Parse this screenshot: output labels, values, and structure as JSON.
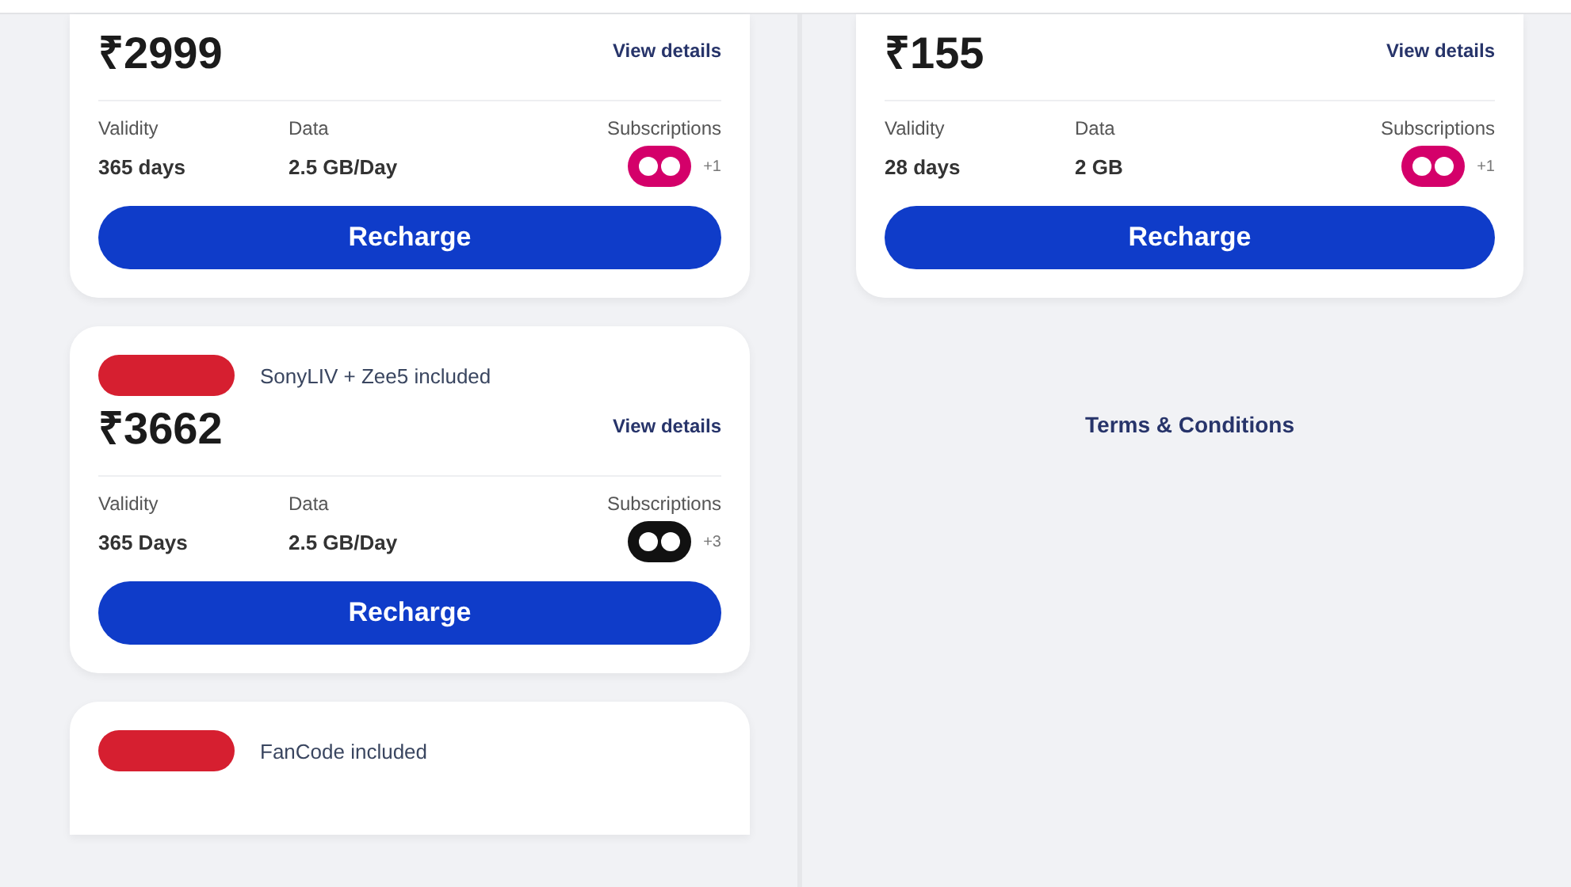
{
  "left_plans": [
    {
      "price": "₹2999",
      "details_link": "View details",
      "validity_label": "Validity",
      "validity": "365 days",
      "data_label": "Data",
      "data": "2.5 GB/Day",
      "subscriptions_label": "Subscriptions",
      "color": "#d4006a",
      "subscriptions_more": "+1",
      "button": "Recharge"
    },
    {
      "badge": true,
      "included": "SonyLIV + Zee5 included",
      "price": "₹3662",
      "details_link": "View details",
      "validity_label": "Validity",
      "validity": "365 Days",
      "data_label": "Data",
      "data": "2.5 GB/Day",
      "subscriptions_label": "Subscriptions",
      "color": "#111111",
      "subscriptions_more": "+3",
      "button": "Recharge"
    },
    {
      "badge": true,
      "included": "FanCode included"
    }
  ],
  "right_plans": [
    {
      "price": "₹155",
      "details_link": "View details",
      "validity_label": "Validity",
      "validity": "28 days",
      "data_label": "Data",
      "data": "2 GB",
      "subscriptions_label": "Subscriptions",
      "color": "#d4006a",
      "subscriptions_more": "+1",
      "button": "Recharge"
    }
  ],
  "terms_link": "Terms & Conditions"
}
